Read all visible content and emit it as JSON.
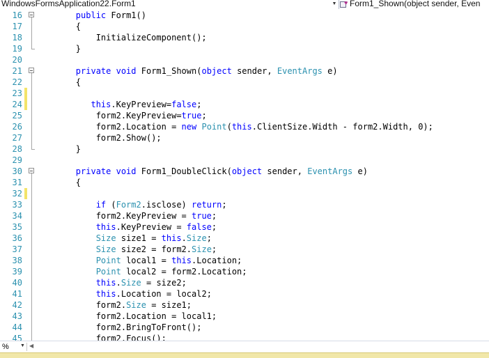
{
  "navbar": {
    "class_selector": "WindowsFormsApplication22.Form1",
    "member_selector": "Form1_Shown(object sender, Even",
    "dropdown_icon": "chevron-down-icon",
    "member_icon": "method-icon"
  },
  "editor": {
    "lines": [
      {
        "num": "16",
        "text": "        public Form1()"
      },
      {
        "num": "17",
        "text": "        {"
      },
      {
        "num": "18",
        "text": "            InitializeComponent();"
      },
      {
        "num": "19",
        "text": "        }"
      },
      {
        "num": "20",
        "text": ""
      },
      {
        "num": "21",
        "text": "        private void Form1_Shown(object sender, EventArgs e)"
      },
      {
        "num": "22",
        "text": "        {"
      },
      {
        "num": "23",
        "text": ""
      },
      {
        "num": "24",
        "text": "           this.KeyPreview=false;"
      },
      {
        "num": "25",
        "text": "            form2.KeyPreview=true;"
      },
      {
        "num": "26",
        "text": "            form2.Location = new Point(this.ClientSize.Width - form2.Width, 0);"
      },
      {
        "num": "27",
        "text": "            form2.Show();"
      },
      {
        "num": "28",
        "text": "        }"
      },
      {
        "num": "29",
        "text": ""
      },
      {
        "num": "30",
        "text": "        private void Form1_DoubleClick(object sender, EventArgs e)"
      },
      {
        "num": "31",
        "text": "        {"
      },
      {
        "num": "32",
        "text": ""
      },
      {
        "num": "33",
        "text": "            if (Form2.isclose) return;"
      },
      {
        "num": "34",
        "text": "            form2.KeyPreview = true;"
      },
      {
        "num": "35",
        "text": "            this.KeyPreview = false;"
      },
      {
        "num": "36",
        "text": "            Size size1 = this.Size;"
      },
      {
        "num": "37",
        "text": "            Size size2 = form2.Size;"
      },
      {
        "num": "38",
        "text": "            Point local1 = this.Location;"
      },
      {
        "num": "39",
        "text": "            Point local2 = form2.Location;"
      },
      {
        "num": "40",
        "text": "            this.Size = size2;"
      },
      {
        "num": "41",
        "text": "            this.Location = local2;"
      },
      {
        "num": "42",
        "text": "            form2.Size = size1;"
      },
      {
        "num": "43",
        "text": "            form2.Location = local1;"
      },
      {
        "num": "44",
        "text": "            form2.BringToFront();"
      },
      {
        "num": "45",
        "text": "            form2.Focus();"
      }
    ],
    "changed_lines": [
      "23",
      "24",
      "32"
    ],
    "fold_lines": [
      "16",
      "21",
      "30"
    ],
    "colors": {
      "keyword": "#0000ff",
      "type": "#2b91af",
      "line_number": "#2b91af",
      "change_marker": "#f3e46a"
    }
  },
  "status": {
    "zoom": "%",
    "zoom_dropdown_icon": "chevron-down-icon",
    "scroll_left_icon": "scroll-left-icon"
  }
}
